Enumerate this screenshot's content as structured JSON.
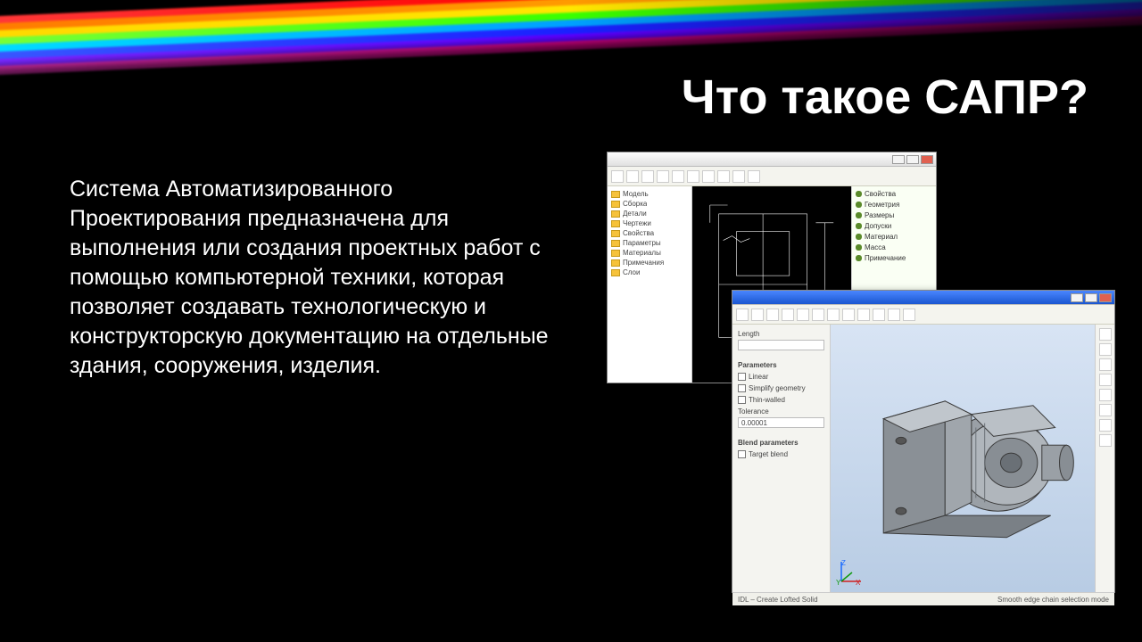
{
  "slide": {
    "title": "Что такое САПР?",
    "body": "Система Автоматизированного Проектирования предназначена для выполнения или создания проектных работ с помощью компьютерной техники, которая позволяет создавать технологическую и конструкторскую документацию на отдельные здания, сооружения, изделия."
  },
  "window1": {
    "tree": [
      "Модель",
      "Сборка",
      "Детали",
      "Чертежи",
      "Свойства",
      "Параметры",
      "Материалы",
      "Примечания",
      "Слои"
    ],
    "rpanel": [
      "Свойства",
      "Геометрия",
      "Размеры",
      "Допуски",
      "Материал",
      "Масса",
      "Примечание"
    ]
  },
  "window2": {
    "panel": {
      "section1": "Parameters",
      "opt_linear": "Linear",
      "opt_simplify": "Simplify geometry",
      "opt_thinwalled": "Thin-walled",
      "tolerance_label": "Tolerance",
      "tolerance_value": "0.00001",
      "section2": "Blend parameters",
      "opt_target": "Target blend"
    },
    "status_left": "IDL – Create Lofted Solid",
    "status_right": "Smooth edge chain selection mode"
  }
}
